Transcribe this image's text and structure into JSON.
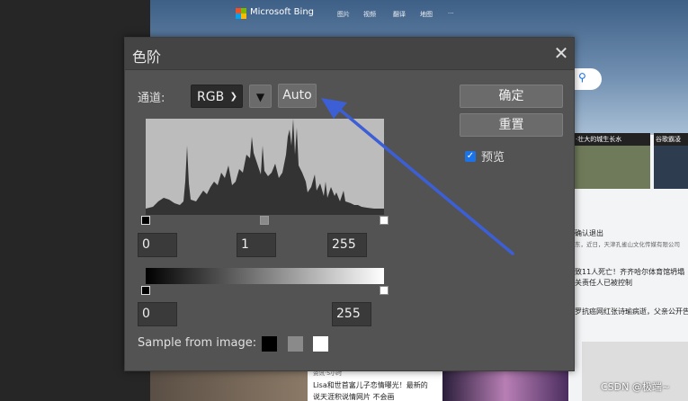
{
  "background": {
    "brand": "Microsoft Bing",
    "nav": [
      "图片",
      "视频",
      "翻译",
      "地图",
      "···"
    ],
    "cards": [
      "·壮大的城生长水",
      "谷歌霸凌"
    ],
    "news": [
      {
        "title": "确认退出",
        "sub": "东，近日，天津孔雀山文化传媒有限公司"
      },
      {
        "title": "致11人死亡！齐齐哈尔体育馆坍塌",
        "sub": ""
      },
      {
        "title": "关责任人已被控制",
        "sub": ""
      },
      {
        "title": "罗抗癌网红张诗瑜病逝，父亲公开告",
        "sub": ""
      }
    ],
    "bottom_card": {
      "source": "资讯·5小时",
      "line1": "Lisa和世首富儿子恋情曝光！最新的",
      "line2": "说天涯积说情网片 不会画"
    },
    "watermark": "CSDN @极端~"
  },
  "dialog": {
    "title": "色阶",
    "close_glyph": "✕",
    "channel_label": "通道:",
    "channel_value": "RGB",
    "dropdown_glyph": "▼",
    "auto_label": "Auto",
    "ok_label": "确定",
    "reset_label": "重置",
    "preview_label": "预览",
    "preview_checked": true,
    "input_levels": {
      "black": "0",
      "gamma": "1",
      "white": "255"
    },
    "output_levels": {
      "black": "0",
      "white": "255"
    },
    "sample_label": "Sample from image:",
    "sample_swatches": [
      "#000000",
      "#8a8a8a",
      "#ffffff"
    ]
  },
  "colors": {
    "dialog_bg": "#535353",
    "button_bg": "#6b6b6b",
    "accent": "#1a73e8",
    "annotation_arrow": "#3d5fd6"
  }
}
